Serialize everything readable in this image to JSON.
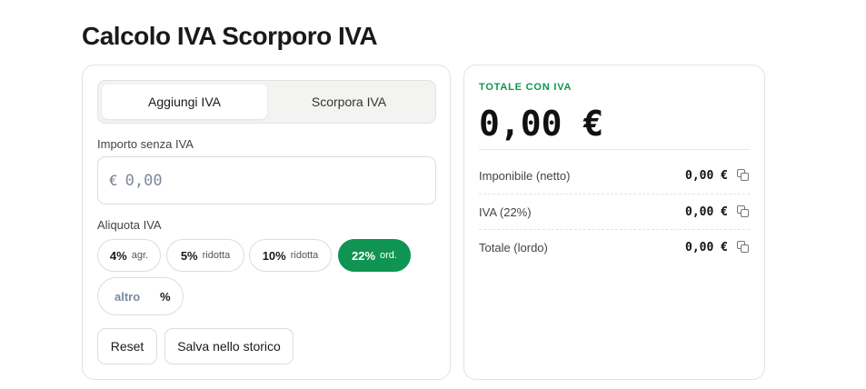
{
  "page": {
    "title": "Calcolo IVA Scorporo IVA"
  },
  "calculator": {
    "tabs": [
      {
        "label": "Aggiungi IVA",
        "active": true
      },
      {
        "label": "Scorpora IVA",
        "active": false
      }
    ],
    "amount": {
      "label": "Importo senza IVA",
      "currency_symbol": "€",
      "placeholder": "0,00",
      "value": ""
    },
    "rate": {
      "label": "Aliquota IVA",
      "options": [
        {
          "percent": "4%",
          "tag": "agr.",
          "selected": false
        },
        {
          "percent": "5%",
          "tag": "ridotta",
          "selected": false
        },
        {
          "percent": "10%",
          "tag": "ridotta",
          "selected": false
        },
        {
          "percent": "22%",
          "tag": "ord.",
          "selected": true
        }
      ],
      "custom": {
        "placeholder": "altro",
        "suffix": "%"
      }
    },
    "buttons": {
      "reset": "Reset",
      "save": "Salva nello storico"
    }
  },
  "result": {
    "total_label": "TOTALE CON IVA",
    "total_value": "0,00 €",
    "rows": [
      {
        "label": "Imponibile (netto)",
        "value": "0,00 €",
        "icon": "copy-icon"
      },
      {
        "label": "IVA (22%)",
        "value": "0,00 €",
        "icon": "copy-icon"
      },
      {
        "label": "Totale (lordo)",
        "value": "0,00 €",
        "icon": "copy-icon"
      }
    ]
  },
  "colors": {
    "accent": "#0f9551",
    "border": "#e2e2e0",
    "muted_text": "#444444"
  }
}
